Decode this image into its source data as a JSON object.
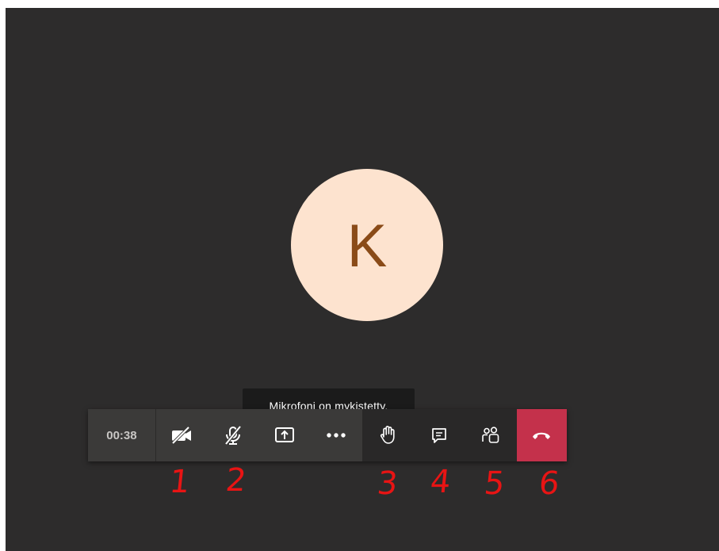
{
  "call": {
    "avatar_initial": "K",
    "tooltip": "Mikrofoni on mykistetty.",
    "timer": "00:38"
  },
  "toolbar": {
    "buttons": [
      {
        "name": "camera-off",
        "icon": "video-off-icon"
      },
      {
        "name": "mic-muted",
        "icon": "mic-off-icon"
      },
      {
        "name": "share",
        "icon": "share-screen-icon"
      },
      {
        "name": "more",
        "icon": "more-icon"
      },
      {
        "name": "raise-hand",
        "icon": "hand-icon"
      },
      {
        "name": "chat",
        "icon": "chat-icon"
      },
      {
        "name": "participants",
        "icon": "people-icon"
      },
      {
        "name": "hang-up",
        "icon": "hang-up-icon"
      }
    ]
  },
  "annotations": [
    "1",
    "2",
    "3",
    "4",
    "5",
    "6"
  ],
  "colors": {
    "background": "#2d2c2c",
    "avatar_bg": "#fde3cf",
    "avatar_text": "#8a4b18",
    "hangup": "#c4314b",
    "annotation": "#e81414"
  }
}
